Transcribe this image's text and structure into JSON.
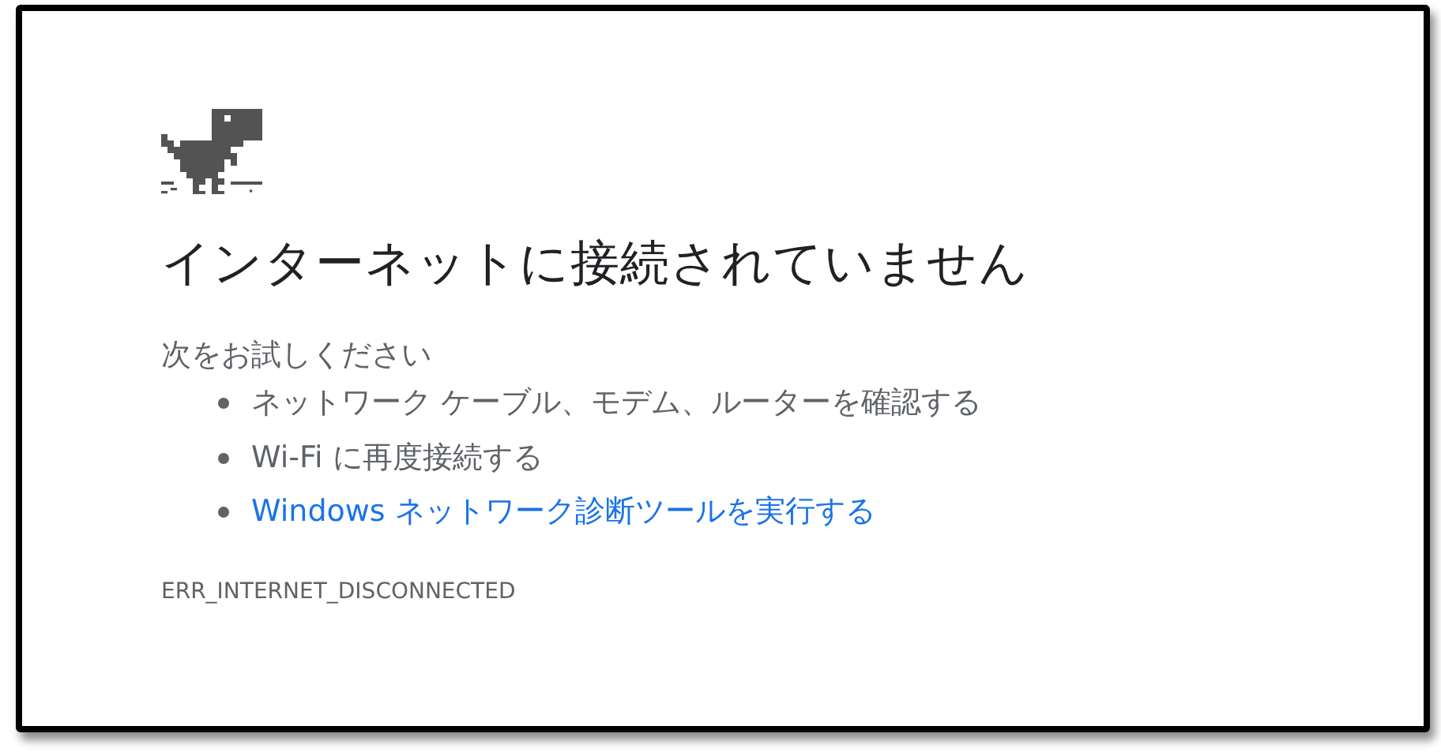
{
  "heading": "インターネットに接続されていません",
  "suggestions_intro": "次をお試しください",
  "suggestions": [
    {
      "kind": "text",
      "text": "ネットワーク ケーブル、モデム、ルーターを確認する"
    },
    {
      "kind": "text",
      "text": "Wi-Fi に再度接続する"
    },
    {
      "kind": "link",
      "text": "Windows ネットワーク診断ツールを実行する"
    }
  ],
  "error_code": "ERR_INTERNET_DISCONNECTED"
}
